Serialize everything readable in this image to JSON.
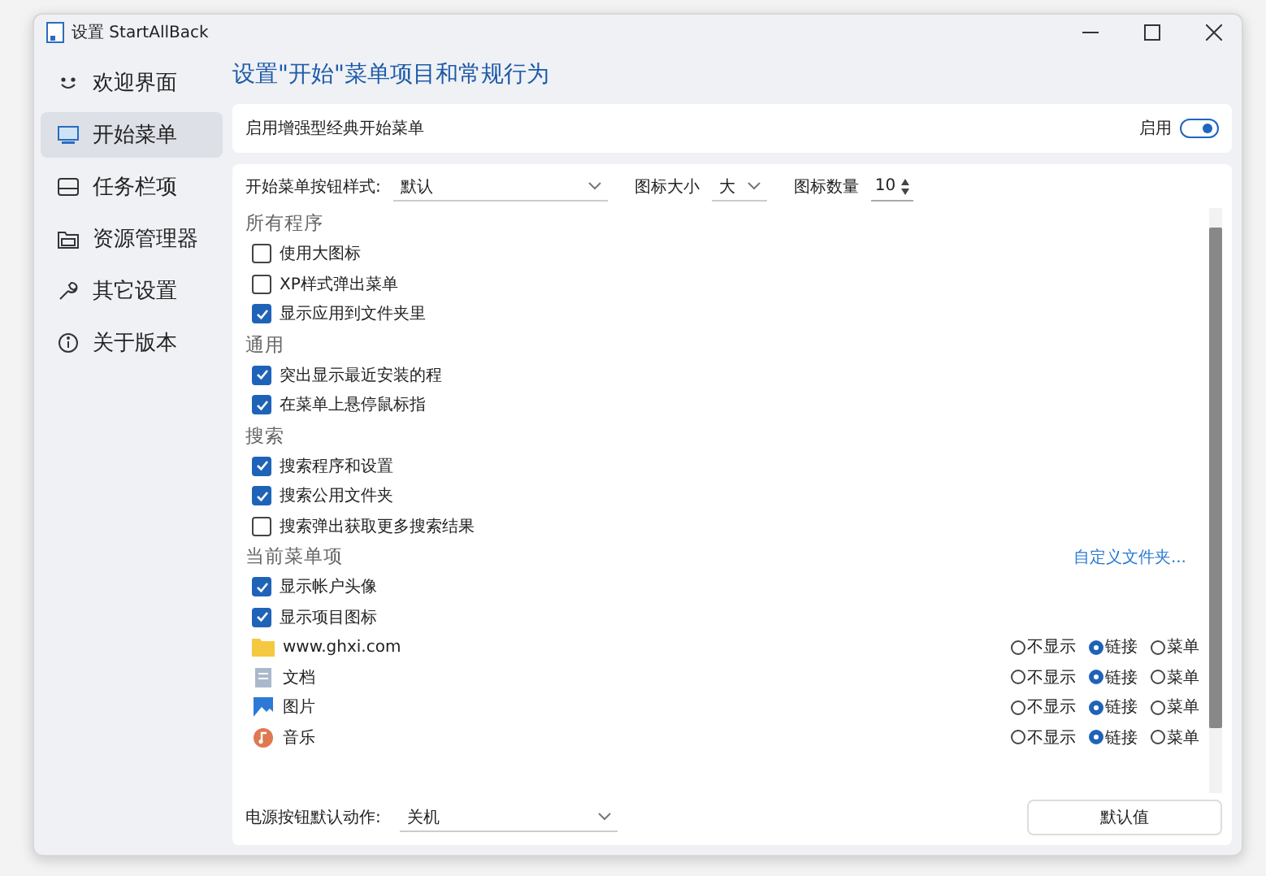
{
  "window": {
    "title": "设置 StartAllBack"
  },
  "sidebar": {
    "items": [
      {
        "label": "欢迎界面",
        "selected": false
      },
      {
        "label": "开始菜单",
        "selected": true
      },
      {
        "label": "任务栏项",
        "selected": false
      },
      {
        "label": "资源管理器",
        "selected": false
      },
      {
        "label": "其它设置",
        "selected": false
      },
      {
        "label": "关于版本",
        "selected": false
      }
    ]
  },
  "heading": "设置\"开始\"菜单项目和常规行为",
  "enable_card": {
    "label": "启用增强型经典开始菜单",
    "toggle_label": "启用",
    "on": true
  },
  "options_bar": {
    "button_style_label": "开始菜单按钮样式:",
    "button_style_value": "默认",
    "icon_size_label": "图标大小",
    "icon_size_value": "大",
    "icon_count_label": "图标数量",
    "icon_count_value": "10"
  },
  "sections": [
    {
      "title": "所有程序",
      "items": [
        {
          "label": "使用大图标",
          "checked": false
        },
        {
          "label": "XP样式弹出菜单",
          "checked": false
        },
        {
          "label": "显示应用到文件夹里",
          "checked": true
        }
      ]
    },
    {
      "title": "通用",
      "items": [
        {
          "label": "突出显示最近安装的程",
          "checked": true
        },
        {
          "label": "在菜单上悬停鼠标指",
          "checked": true
        }
      ]
    },
    {
      "title": "搜索",
      "items": [
        {
          "label": "搜索程序和设置",
          "checked": true
        },
        {
          "label": "搜索公用文件夹",
          "checked": true
        },
        {
          "label": "搜索弹出获取更多搜索结果",
          "checked": false
        }
      ]
    },
    {
      "title": "当前菜单项",
      "items": [
        {
          "label": "显示帐户头像",
          "checked": true
        },
        {
          "label": "显示项目图标",
          "checked": true
        }
      ]
    }
  ],
  "custom_folder_link": "自定义文件夹...",
  "menu_items": [
    {
      "label": "www.ghxi.com",
      "kind": "folder",
      "options": [
        {
          "label": "不显示",
          "selected": false
        },
        {
          "label": "链接",
          "selected": true
        },
        {
          "label": "菜单",
          "selected": false
        }
      ]
    },
    {
      "label": "文档",
      "kind": "document",
      "options": [
        {
          "label": "不显示",
          "selected": false
        },
        {
          "label": "链接",
          "selected": true
        },
        {
          "label": "菜单",
          "selected": false
        }
      ]
    },
    {
      "label": "图片",
      "kind": "picture",
      "options": [
        {
          "label": "不显示",
          "selected": false
        },
        {
          "label": "链接",
          "selected": true
        },
        {
          "label": "菜单",
          "selected": false
        }
      ]
    },
    {
      "label": "音乐",
      "kind": "music",
      "options": [
        {
          "label": "不显示",
          "selected": false
        },
        {
          "label": "链接",
          "selected": true
        },
        {
          "label": "菜单",
          "selected": false
        }
      ]
    }
  ],
  "power": {
    "label": "电源按钮默认动作:",
    "value": "关机"
  },
  "default_button": "默认值"
}
